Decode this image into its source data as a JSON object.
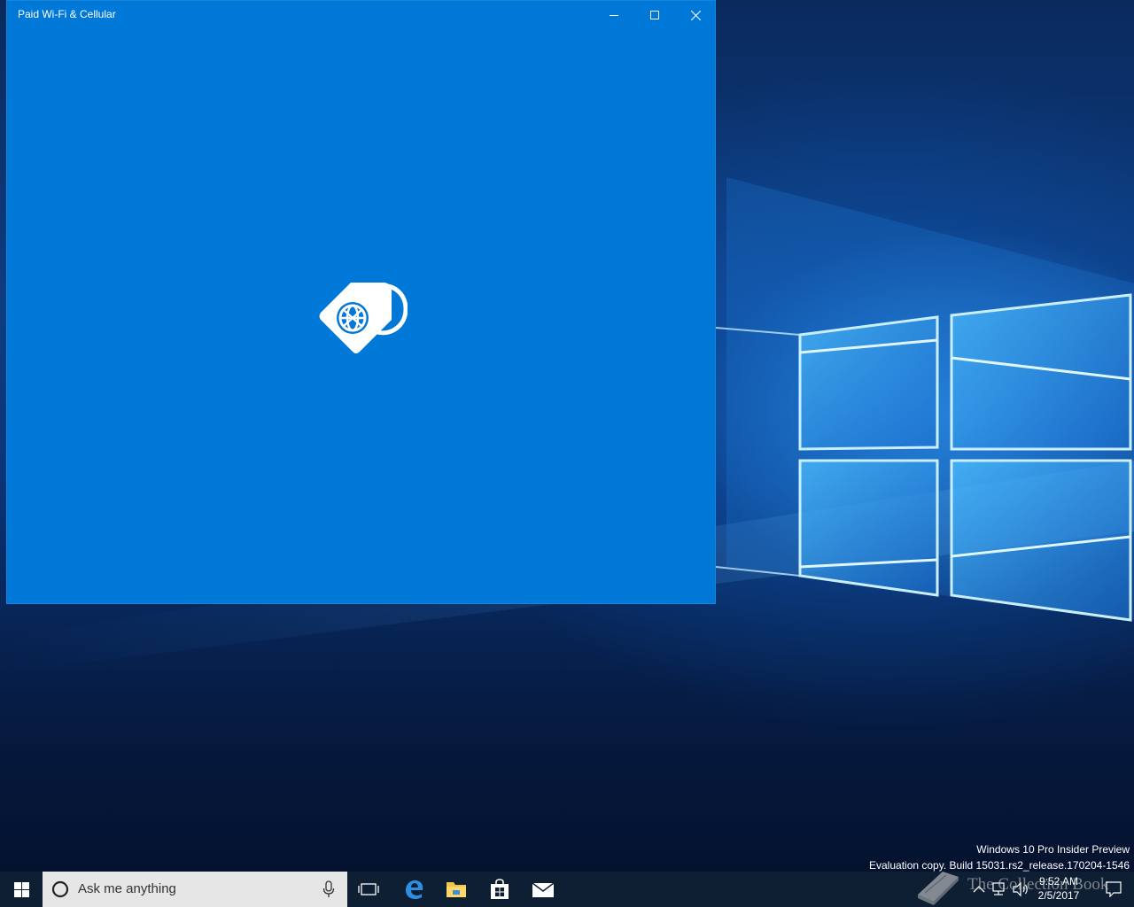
{
  "window": {
    "title": "Paid Wi-Fi & Cellular",
    "background_color": "#0078d7",
    "splash_icon": "sim-tag-globe-icon"
  },
  "caption_buttons": {
    "minimize_icon": "minimize-icon",
    "maximize_icon": "maximize-icon",
    "close_icon": "close-icon"
  },
  "watermark": {
    "line1": "Windows 10 Pro Insider Preview",
    "line2": "Evaluation copy. Build 15031.rs2_release.170204-1546"
  },
  "taskbar": {
    "start_icon": "windows-logo-icon",
    "search_placeholder": "Ask me anything",
    "pinned_apps": [
      "task-view-icon",
      "edge-icon",
      "file-explorer-icon",
      "store-icon",
      "mail-icon"
    ],
    "clock_time": "9:52 AM",
    "clock_date": "2/5/2017",
    "tray_icons": [
      "chevron-up-icon",
      "network-icon",
      "volume-icon"
    ],
    "notification_icon": "action-center-icon"
  },
  "overlay_logo": {
    "text": "The Collection Book"
  }
}
